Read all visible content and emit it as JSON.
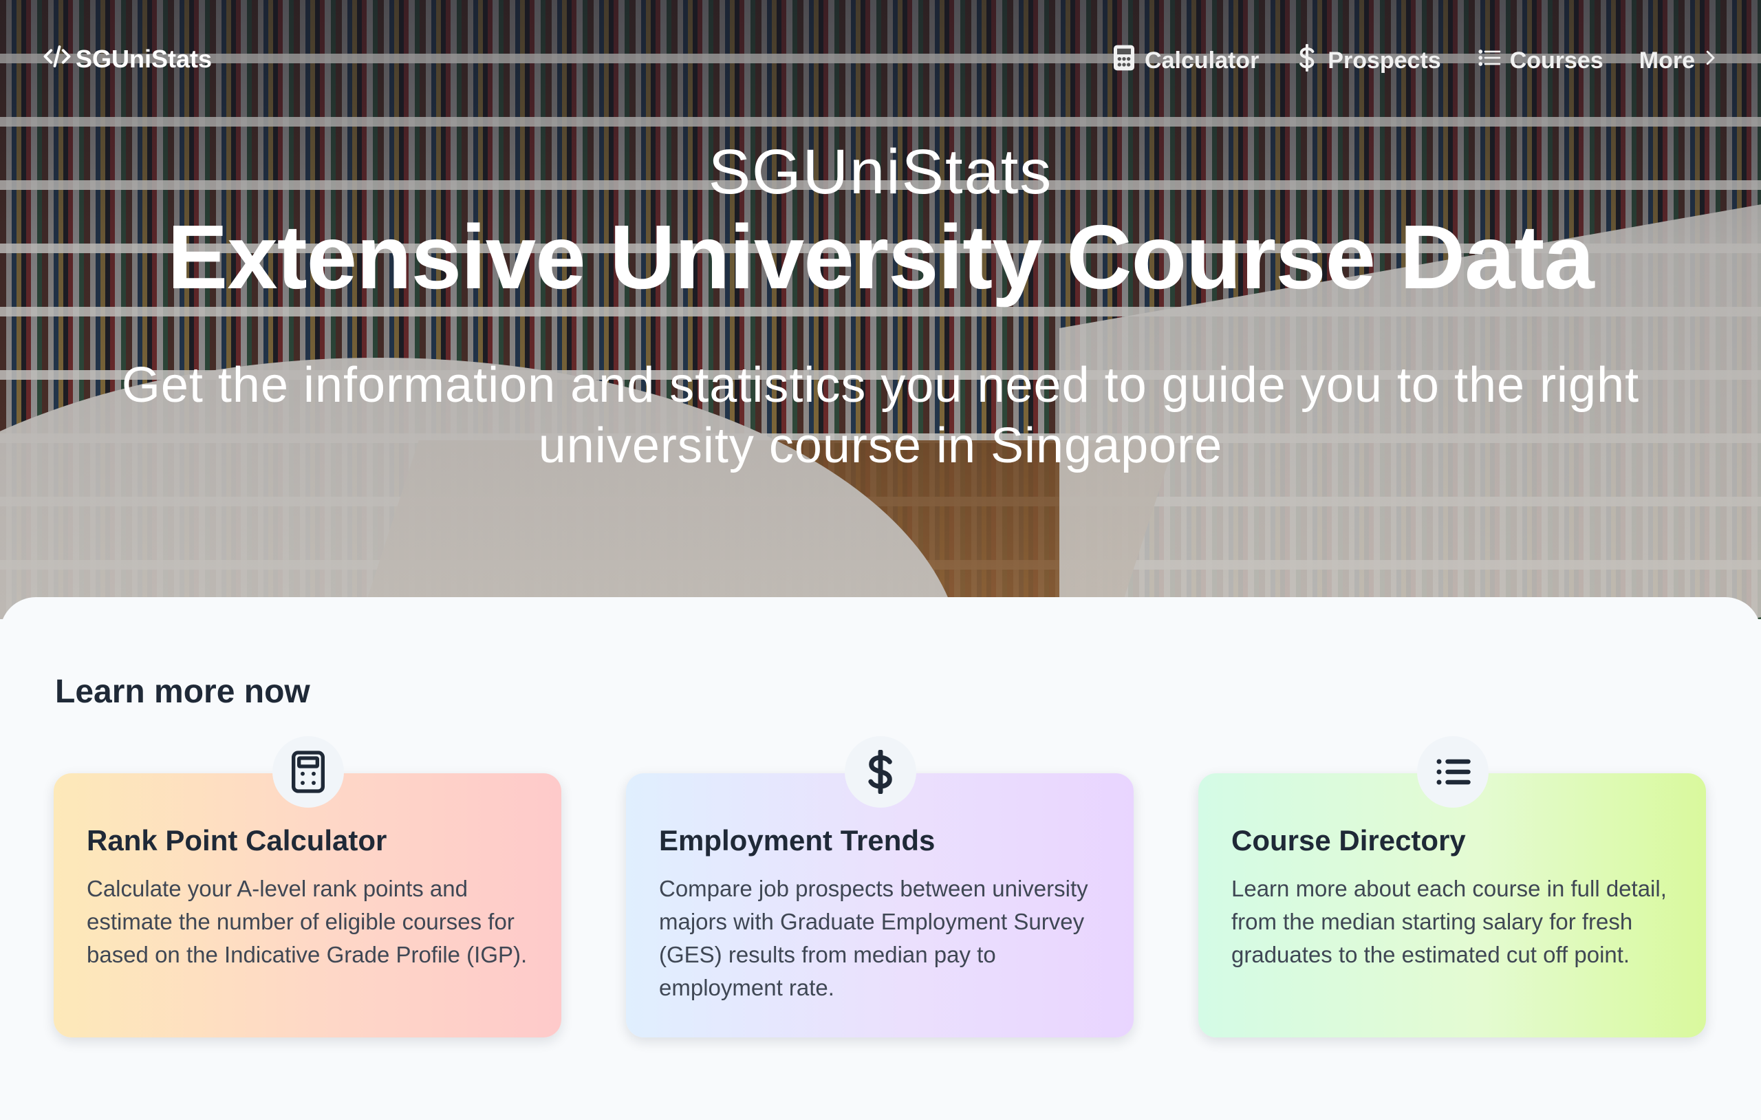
{
  "nav": {
    "brand": "SGUniStats",
    "links": [
      {
        "label": "Calculator",
        "icon": "calculator-icon"
      },
      {
        "label": "Prospects",
        "icon": "dollar-icon"
      },
      {
        "label": "Courses",
        "icon": "list-icon"
      },
      {
        "label": "More",
        "icon": "chevron-right-icon"
      }
    ]
  },
  "hero": {
    "kicker": "SGUniStats",
    "title": "Extensive University Course Data",
    "subtitle": "Get the information and statistics you need to guide you to the right university course in Singapore"
  },
  "section": {
    "title": "Learn more now",
    "cards": [
      {
        "title": "Rank Point Calculator",
        "description": "Calculate your A-level rank points and estimate the number of eligible courses for based on the Indicative Grade Profile (IGP).",
        "icon": "calculator-icon"
      },
      {
        "title": "Employment Trends",
        "description": "Compare job prospects between university majors with Graduate Employment Survey (GES) results from median pay to employment rate.",
        "icon": "dollar-icon"
      },
      {
        "title": "Course Directory",
        "description": "Learn more about each course in full detail, from the median starting salary for fresh graduates to the estimated cut off point.",
        "icon": "list-icon"
      }
    ]
  },
  "colors": {
    "text_dark": "#1f2937",
    "panel_bg": "#f8fafc",
    "card_1_gradient": [
      "#fde9b9",
      "#fecaca"
    ],
    "card_2_gradient": [
      "#e0effe",
      "#e9d5ff"
    ],
    "card_3_gradient": [
      "#d4fbe6",
      "#d9f99d"
    ]
  }
}
